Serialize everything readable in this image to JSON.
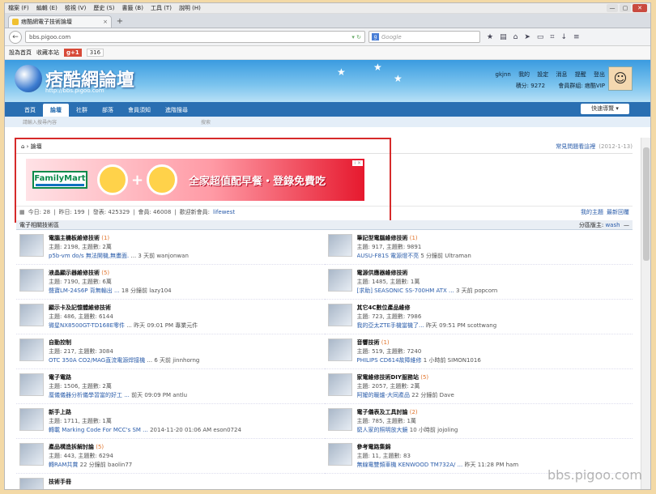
{
  "menubar": {
    "items": [
      "檔案 (F)",
      "編輯 (E)",
      "檢視 (V)",
      "歷史 (S)",
      "書籤 (B)",
      "工具 (T)",
      "說明 (H)"
    ],
    "min": "—",
    "max": "▢",
    "close": "✕"
  },
  "tab": {
    "title": "痞酷網電子技術論壇",
    "close": "×",
    "newtab": "+"
  },
  "navbar": {
    "url": "bbs.pigoo.com",
    "search_placeholder": "Google",
    "search_engine": "g"
  },
  "bookmarks": {
    "item1": "設為首頁",
    "item2": "收藏本站",
    "gplus": "g+1",
    "gcount": "316"
  },
  "site": {
    "logo_text": "痞酷網論壇",
    "logo_url": "http://bbs.pigoo.com",
    "user": {
      "name": "gkjnn",
      "links": [
        "我的",
        "設定",
        "消息",
        "提醒",
        "登出"
      ],
      "points": "積分: 9272",
      "group": "會員群組: 痞酷VIP"
    }
  },
  "sitenav": {
    "items": [
      "首頁",
      "論壇",
      "社群",
      "部落",
      "會員須知",
      "進階搜尋"
    ],
    "quicknav": "快速導覽 ▾",
    "search_placeholder": "請輸入搜尋內容",
    "search_label": "搜索"
  },
  "crumb": {
    "label": "論壇",
    "faq": "常見問題看這裡",
    "faq_date": "(2012-1-13)"
  },
  "banner": {
    "brand": "FamilyMart",
    "text": "全家超值配早餐・登錄免費吃",
    "adtag": "i ✕"
  },
  "stats": {
    "today": "今日: 28",
    "yesterday": "昨日: 199",
    "posts": "發表: 425329",
    "members": "會員: 46008",
    "newmember_label": "歡迎新會員:",
    "newmember": "lifewest",
    "mythreads": "我的主題",
    "latest": "最新回覆"
  },
  "section": {
    "title": "電子相關技術區",
    "mod_label": "分區版主:",
    "mod": "wash",
    "collapse": "—"
  },
  "forums": [
    {
      "name": "電腦主機板維修技術",
      "new": "(1)",
      "stats": "主題: 2198, 主題數: 2萬",
      "last_title": "p5b-vm do/s 無法開機,無畫面.",
      "last_meta": "... 3 天前 wanjonwan"
    },
    {
      "name": "筆記型電腦維修技術",
      "new": "(1)",
      "stats": "主題: 917, 主題數: 9891",
      "last_title": "AUSU-F81S 電源燈不亮",
      "last_meta": "5 分鐘前 Ultraman"
    },
    {
      "name": "液晶顯示器維修技術",
      "new": "(5)",
      "stats": "主題: 7190, 主題數: 6萬",
      "last_title": "聲寶LM-24S6P 背無輸出 ...",
      "last_meta": "18 分鐘前 lazy104"
    },
    {
      "name": "電源供應器維修技術",
      "new": "",
      "stats": "主題: 1485, 主題數: 1萬",
      "last_title": "[求助] SEASONIC SS-700HM ATX ...",
      "last_meta": "3 天前 popcorn"
    },
    {
      "name": "顯示卡及記憶體維修技術",
      "new": "",
      "stats": "主題: 486, 主題數: 6144",
      "last_title": "微星NX8500GT-TD168E零件",
      "last_meta": "... 昨天 09:01 PM 專業元件"
    },
    {
      "name": "其它4C數位產品維修",
      "new": "",
      "stats": "主題: 723, 主題數: 7986",
      "last_title": "我的亞太ZTE手機當機了...",
      "last_meta": "昨天 09:51 PM scottwang"
    },
    {
      "name": "自動控制",
      "new": "",
      "stats": "主題: 217, 主題數: 3084",
      "last_title": "OTC 350A CO2/MAG直流電源焊接機",
      "last_meta": "... 6 天前 jinnhorng"
    },
    {
      "name": "音響技術",
      "new": "(1)",
      "stats": "主題: 519, 主題數: 7240",
      "last_title": "PHILIPS CD614故障維修",
      "last_meta": "1 小時前 SIMON1016"
    },
    {
      "name": "電子電路",
      "new": "",
      "stats": "主題: 1506, 主題數: 2萬",
      "last_title": "厘儀儀器分析儀學習當的好工 ...",
      "last_meta": "前天 09:09 PM antlu"
    },
    {
      "name": "家電維修技術DIY服務站",
      "new": "(5)",
      "stats": "主題: 2057, 主題數: 2萬",
      "last_title": "阿嬤的暖爐-大同產品",
      "last_meta": "22 分鐘前 Dave"
    },
    {
      "name": "新手上路",
      "new": "",
      "stats": "主題: 1711, 主題數: 1萬",
      "last_title": "轉載 Marking Code For MCC's SM ...",
      "last_meta": "2014-11-20 01:06 AM eson0724"
    },
    {
      "name": "電子儀表及工具討論",
      "new": "(2)",
      "stats": "主題: 785, 主題數: 1萬",
      "last_title": "窮人家的照明放大鏡",
      "last_meta": "10 小時前 jojoling"
    },
    {
      "name": "產品構造拆解討論",
      "new": "(5)",
      "stats": "主題: 443, 主題數: 6294",
      "last_title": "轉RAM共賞",
      "last_meta": "22 分鐘前 baolin77"
    },
    {
      "name": "參考電路集錦",
      "new": "",
      "stats": "主題: 11, 主題數: 83",
      "last_title": "無線電雙頻車機 KENWOOD TM732A/ ...",
      "last_meta": "昨天 11:28 PM ham"
    },
    {
      "name": "技術手冊",
      "new": "",
      "stats": "",
      "last_title": "",
      "last_meta": ""
    }
  ],
  "watermark": "bbs.pigoo.com"
}
